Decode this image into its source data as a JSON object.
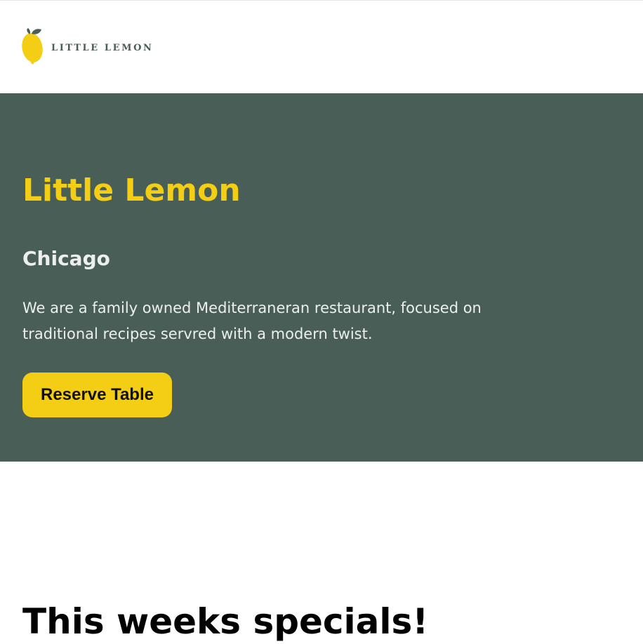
{
  "header": {
    "logo": {
      "text": "LITTLE LEMON",
      "icon": "lemon-icon"
    }
  },
  "hero": {
    "title": "Little Lemon",
    "subtitle": "Chicago",
    "description": "We are a family owned Mediterraneran restaurant, focused on traditional recipes servred with a modern twist.",
    "button_label": "Reserve Table"
  },
  "specials": {
    "title": "This weeks specials!"
  },
  "colors": {
    "primary_green": "#495e57",
    "primary_yellow": "#f4ce14",
    "light_text": "#edefee",
    "background": "#ffffff"
  }
}
